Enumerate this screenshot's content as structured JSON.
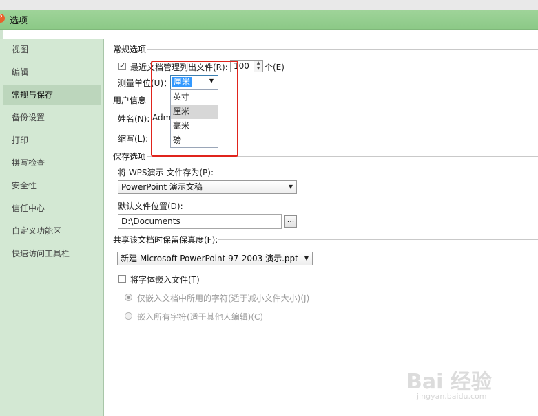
{
  "window": {
    "title": "选项",
    "icon": "wps-presentation-icon",
    "accent": "#8cc987"
  },
  "sidebar": {
    "items": [
      {
        "label": "视图"
      },
      {
        "label": "编辑"
      },
      {
        "label": "常规与保存",
        "active": true
      },
      {
        "label": "备份设置"
      },
      {
        "label": "打印"
      },
      {
        "label": "拼写检查"
      },
      {
        "label": "安全性"
      },
      {
        "label": "信任中心"
      },
      {
        "label": "自定义功能区"
      },
      {
        "label": "快速访问工具栏"
      }
    ]
  },
  "general": {
    "section_title": "常规选项",
    "recent_docs_label": "最近文档管理列出文件(R):",
    "recent_docs_checked": true,
    "recent_docs_value": "100",
    "recent_docs_unit": "个(E)",
    "measure_unit_label": "测量单位(U)：",
    "measure_unit_value": "厘米",
    "measure_unit_options": [
      "英寸",
      "厘米",
      "毫米",
      "磅"
    ]
  },
  "user_info": {
    "section_title": "用户信息",
    "name_label": "姓名(N):",
    "name_value": "Adm",
    "initials_label": "缩写(L):"
  },
  "save_options": {
    "section_title": "保存选项",
    "save_as_label": "将 WPS演示 文件存为(P):",
    "save_as_value": "PowerPoint 演示文稿",
    "default_location_label": "默认文件位置(D):",
    "default_location_value": "D:\\Documents",
    "browse_label": "..."
  },
  "fidelity": {
    "section_title": "共享该文档时保留保真度(F):",
    "document_value": "新建 Microsoft PowerPoint 97-2003 演示.ppt",
    "embed_fonts_label": "将字体嵌入文件(T)",
    "embed_fonts_checked": false,
    "embed_used_label": "仅嵌入文档中所用的字符(适于减小文件大小)(J)",
    "embed_all_label": "嵌入所有字符(适于其他人编辑)(C)"
  },
  "watermark": {
    "brand": "Bai 经验",
    "url": "jingyan.baidu.com"
  }
}
